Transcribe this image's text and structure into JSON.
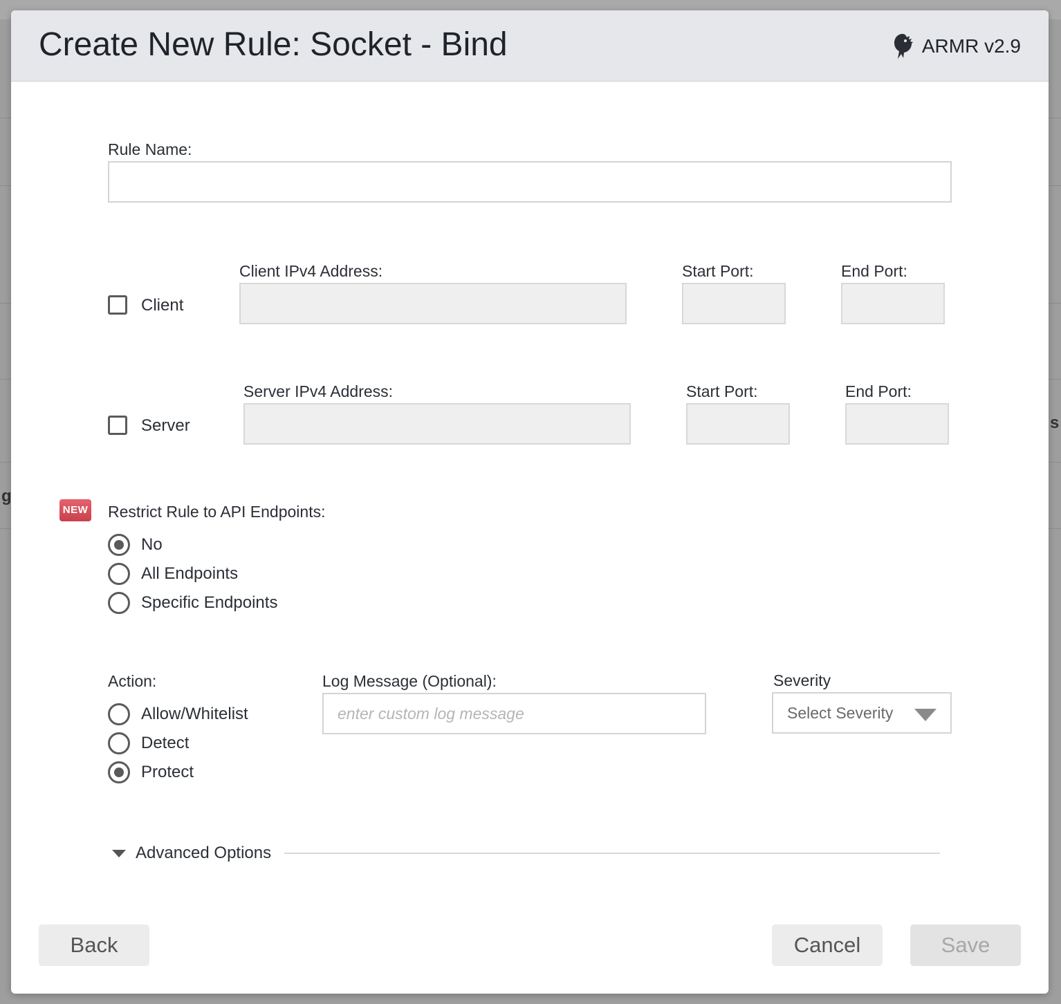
{
  "background": {
    "left_glyph": "g",
    "right_glyph": "s"
  },
  "header": {
    "title": "Create New Rule: Socket - Bind",
    "brand": "ARMR v2.9",
    "brand_icon": "dragon-logo-icon"
  },
  "rule_name": {
    "label": "Rule Name:",
    "value": "",
    "placeholder": ""
  },
  "client": {
    "checkbox_label": "Client",
    "checked": false,
    "address_label": "Client IPv4 Address:",
    "address_value": "",
    "start_port_label": "Start Port:",
    "start_port_value": "",
    "end_port_label": "End Port:",
    "end_port_value": ""
  },
  "server": {
    "checkbox_label": "Server",
    "checked": false,
    "address_label": "Server IPv4 Address:",
    "address_value": "",
    "start_port_label": "Start Port:",
    "start_port_value": "",
    "end_port_label": "End Port:",
    "end_port_value": ""
  },
  "restrict": {
    "badge": "NEW",
    "label": "Restrict Rule to API Endpoints:",
    "options": [
      {
        "label": "No",
        "checked": true
      },
      {
        "label": "All Endpoints",
        "checked": false
      },
      {
        "label": "Specific Endpoints",
        "checked": false
      }
    ]
  },
  "action": {
    "label": "Action:",
    "options": [
      {
        "label": "Allow/Whitelist",
        "checked": false
      },
      {
        "label": "Detect",
        "checked": false
      },
      {
        "label": "Protect",
        "checked": true
      }
    ]
  },
  "log_message": {
    "label": "Log Message (Optional):",
    "value": "",
    "placeholder": "enter custom log message"
  },
  "severity": {
    "label": "Severity",
    "selected": "Select Severity"
  },
  "advanced": {
    "label": "Advanced Options",
    "expanded": false
  },
  "footer": {
    "back_label": "Back",
    "cancel_label": "Cancel",
    "save_label": "Save",
    "save_disabled": true
  }
}
